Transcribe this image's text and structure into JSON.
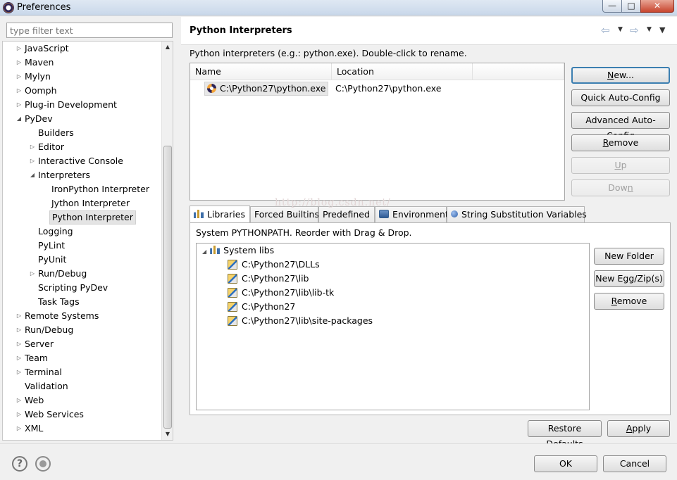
{
  "window": {
    "title": "Preferences",
    "minimize_glyph": "—",
    "maximize_glyph": "□",
    "close_glyph": "✕"
  },
  "filter": {
    "placeholder": "type filter text"
  },
  "tree": {
    "items": [
      {
        "label": "JavaScript",
        "level": 0,
        "twisty": "collapsed"
      },
      {
        "label": "Maven",
        "level": 0,
        "twisty": "collapsed"
      },
      {
        "label": "Mylyn",
        "level": 0,
        "twisty": "collapsed"
      },
      {
        "label": "Oomph",
        "level": 0,
        "twisty": "collapsed"
      },
      {
        "label": "Plug-in Development",
        "level": 0,
        "twisty": "collapsed"
      },
      {
        "label": "PyDev",
        "level": 0,
        "twisty": "expanded"
      },
      {
        "label": "Builders",
        "level": 1,
        "twisty": "none"
      },
      {
        "label": "Editor",
        "level": 1,
        "twisty": "collapsed"
      },
      {
        "label": "Interactive Console",
        "level": 1,
        "twisty": "collapsed"
      },
      {
        "label": "Interpreters",
        "level": 1,
        "twisty": "expanded"
      },
      {
        "label": "IronPython Interpreter",
        "level": 2,
        "twisty": "none"
      },
      {
        "label": "Jython Interpreter",
        "level": 2,
        "twisty": "none"
      },
      {
        "label": "Python Interpreter",
        "level": 2,
        "twisty": "none",
        "selected": true
      },
      {
        "label": "Logging",
        "level": 1,
        "twisty": "none"
      },
      {
        "label": "PyLint",
        "level": 1,
        "twisty": "none"
      },
      {
        "label": "PyUnit",
        "level": 1,
        "twisty": "none"
      },
      {
        "label": "Run/Debug",
        "level": 1,
        "twisty": "collapsed"
      },
      {
        "label": "Scripting PyDev",
        "level": 1,
        "twisty": "none"
      },
      {
        "label": "Task Tags",
        "level": 1,
        "twisty": "none"
      },
      {
        "label": "Remote Systems",
        "level": 0,
        "twisty": "collapsed"
      },
      {
        "label": "Run/Debug",
        "level": 0,
        "twisty": "collapsed"
      },
      {
        "label": "Server",
        "level": 0,
        "twisty": "collapsed"
      },
      {
        "label": "Team",
        "level": 0,
        "twisty": "collapsed"
      },
      {
        "label": "Terminal",
        "level": 0,
        "twisty": "collapsed"
      },
      {
        "label": "Validation",
        "level": 0,
        "twisty": "none"
      },
      {
        "label": "Web",
        "level": 0,
        "twisty": "collapsed"
      },
      {
        "label": "Web Services",
        "level": 0,
        "twisty": "collapsed"
      },
      {
        "label": "XML",
        "level": 0,
        "twisty": "collapsed"
      }
    ]
  },
  "page": {
    "title": "Python Interpreters",
    "intro": "Python interpreters (e.g.: python.exe).   Double-click to rename.",
    "table": {
      "columns": [
        "Name",
        "Location"
      ],
      "rows": [
        {
          "name": "C:\\Python27\\python.exe",
          "location": "C:\\Python27\\python.exe"
        }
      ]
    },
    "buttons": {
      "new_pre": "",
      "new_u": "N",
      "new_post": "ew...",
      "quick": "Quick Auto-Config",
      "advanced": "Advanced Auto-Config",
      "remove_u": "R",
      "remove_post": "emove",
      "up_u": "U",
      "up_post": "p",
      "down_pre": "Dow",
      "down_u": "n",
      "down_post": ""
    },
    "tabs": [
      "Libraries",
      "Forced Builtins",
      "Predefined",
      "Environment",
      "String Substitution Variables"
    ],
    "libraries": {
      "label": "System PYTHONPATH.   Reorder with Drag & Drop.",
      "root": "System libs",
      "items": [
        "C:\\Python27\\DLLs",
        "C:\\Python27\\lib",
        "C:\\Python27\\lib\\lib-tk",
        "C:\\Python27",
        "C:\\Python27\\lib\\site-packages"
      ],
      "buttons": {
        "new_folder": "New Folder",
        "new_egg": "New Egg/Zip(s)",
        "remove_u": "R",
        "remove_post": "emove"
      }
    },
    "watermark": "http://blog.csdn.net/",
    "restore": {
      "pre": "Restore ",
      "u": "D",
      "post": "efaults"
    },
    "apply": {
      "pre": "",
      "u": "A",
      "post": "pply"
    }
  },
  "footer": {
    "help_glyph": "?",
    "ok": "OK",
    "cancel": "Cancel"
  }
}
